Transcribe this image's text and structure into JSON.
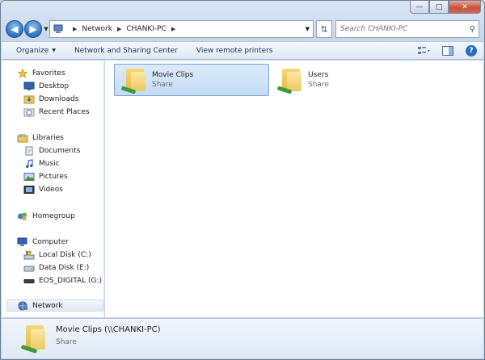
{
  "window": {
    "caption_buttons": [
      "minimize",
      "maximize",
      "close"
    ]
  },
  "address": {
    "segments": [
      "Network",
      "CHANKI-PC"
    ],
    "computer_icon": "computer-icon"
  },
  "search": {
    "placeholder": "Search CHANKI-PC"
  },
  "toolbar": {
    "organize": "Organize",
    "network_sharing": "Network and Sharing Center",
    "view_printers": "View remote printers"
  },
  "sidebar": {
    "favorites": "Favorites",
    "desktop": "Desktop",
    "downloads": "Downloads",
    "recent": "Recent Places",
    "libraries": "Libraries",
    "documents": "Documents",
    "music": "Music",
    "pictures": "Pictures",
    "videos": "Videos",
    "homegroup": "Homegroup",
    "computer": "Computer",
    "local_disk": "Local Disk (C:)",
    "data_disk": "Data Disk (E:)",
    "eos": "EOS_DIGITAL (G:)",
    "network": "Network"
  },
  "items": [
    {
      "name": "Movie Clips",
      "sub": "Share",
      "selected": true
    },
    {
      "name": "Users",
      "sub": "Share",
      "selected": false
    }
  ],
  "details": {
    "name": "Movie Clips (\\\\CHANKI-PC)",
    "sub": "Share"
  },
  "colors": {
    "accent": "#2c6ec6",
    "selection": "#c4dcf6",
    "folder": "#edc862",
    "share": "#3e9a3a"
  }
}
